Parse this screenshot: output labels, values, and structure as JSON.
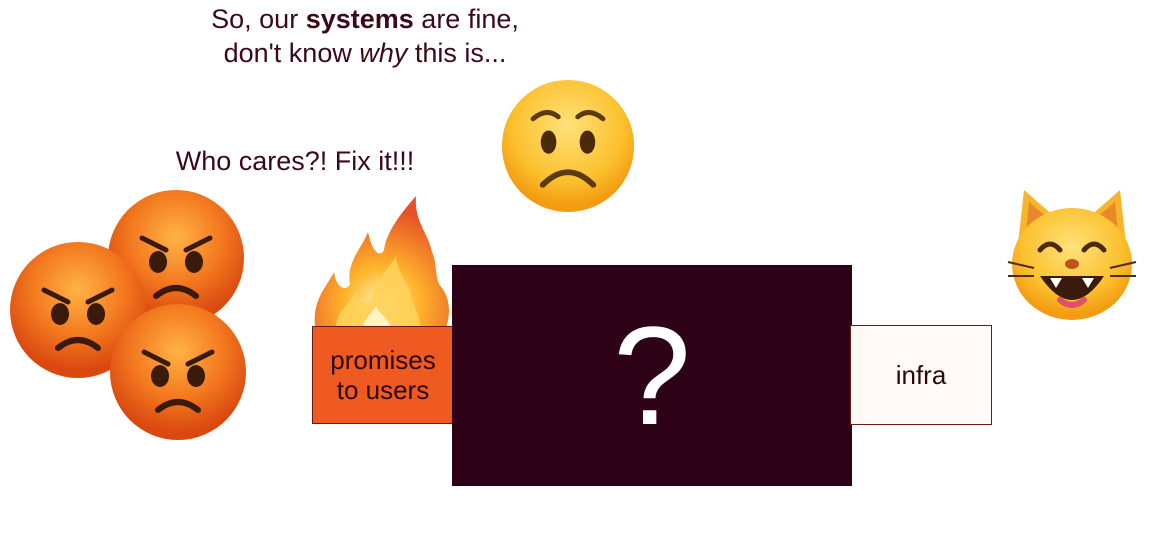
{
  "speech": {
    "infra_team": {
      "line1_pre": "So, our ",
      "line1_bold": "systems",
      "line1_post": " are fine,",
      "line2_pre": "don't know ",
      "line2_italic": "why",
      "line2_post": " this is..."
    },
    "users": "Who cares?! Fix it!!!"
  },
  "boxes": {
    "promises": {
      "line1": "promises",
      "line2": "to users",
      "color": "#ee5a1f"
    },
    "mystery": {
      "label": "?",
      "color": "#2e0318"
    },
    "infra": {
      "label": "infra",
      "color": "#fffaf7"
    }
  },
  "icons": {
    "angry": "angry-face-icon",
    "worried": "worried-face-icon",
    "cat": "grinning-cat-icon",
    "fire": "fire-icon"
  }
}
